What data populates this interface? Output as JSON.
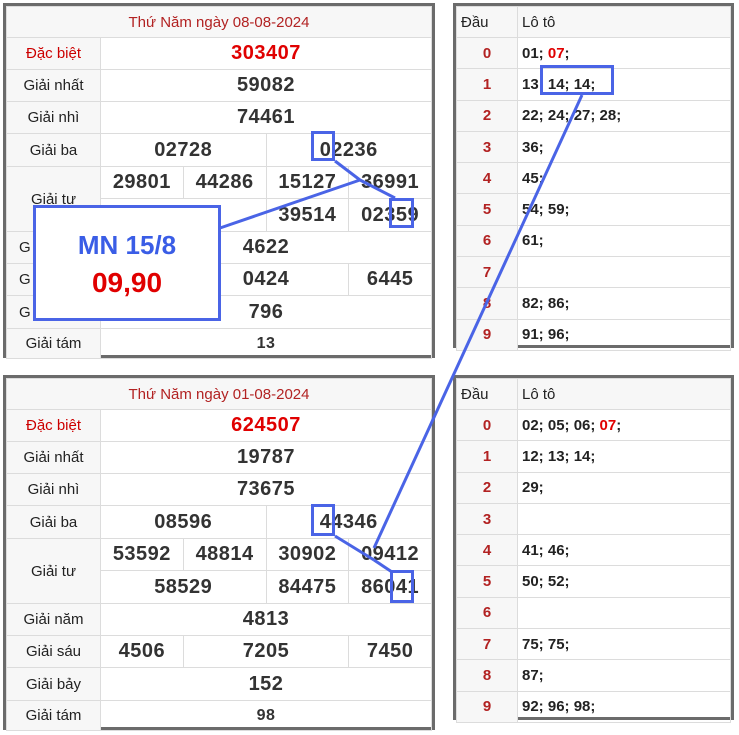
{
  "colors": {
    "accent_blue": "#4a64e6",
    "red": "#e00000",
    "border": "#6b6b6b"
  },
  "draw1": {
    "title": "Thứ Năm ngày 08-08-2024",
    "dac_biet_label": "Đặc biệt",
    "dac_biet": "303407",
    "nhat_label": "Giải nhất",
    "nhat": "59082",
    "nhi_label": "Giải nhì",
    "nhi": "74461",
    "ba_label": "Giải ba",
    "ba": [
      "02728",
      "02236"
    ],
    "tu_label": "Giải tư",
    "tu_row1": [
      "29801",
      "44286",
      "15127",
      "36991"
    ],
    "tu_row2": [
      "",
      "39514",
      "02359"
    ],
    "nam_label": "G",
    "nam": "4622",
    "sau_label": "G",
    "sau": [
      "",
      "0424",
      "6445"
    ],
    "bay_label": "G",
    "bay": "796",
    "tam_label": "Giải tám",
    "tam": "13"
  },
  "loto1": {
    "head_dau": "Đầu",
    "head_loto": "Lô tô",
    "rows": [
      {
        "d": "0",
        "pre": "01; ",
        "red": "07",
        "post": ";"
      },
      {
        "d": "1",
        "pre": "13; 14; 14;",
        "red": "",
        "post": ""
      },
      {
        "d": "2",
        "pre": "22; 24; 27; 28;",
        "red": "",
        "post": ""
      },
      {
        "d": "3",
        "pre": "36;",
        "red": "",
        "post": ""
      },
      {
        "d": "4",
        "pre": "45;",
        "red": "",
        "post": ""
      },
      {
        "d": "5",
        "pre": "54; 59;",
        "red": "",
        "post": ""
      },
      {
        "d": "6",
        "pre": "61;",
        "red": "",
        "post": ""
      },
      {
        "d": "7",
        "pre": "",
        "red": "",
        "post": ""
      },
      {
        "d": "8",
        "pre": "82; 86;",
        "red": "",
        "post": ""
      },
      {
        "d": "9",
        "pre": "91; 96;",
        "red": "",
        "post": ""
      }
    ]
  },
  "draw2": {
    "title": "Thứ Năm ngày 01-08-2024",
    "dac_biet_label": "Đặc biệt",
    "dac_biet": "624507",
    "nhat_label": "Giải nhất",
    "nhat": "19787",
    "nhi_label": "Giải nhì",
    "nhi": "73675",
    "ba_label": "Giải ba",
    "ba": [
      "08596",
      "44346"
    ],
    "tu_label": "Giải tư",
    "tu_row1": [
      "53592",
      "48814",
      "30902",
      "09412"
    ],
    "tu_row2": [
      "58529",
      "84475",
      "86041"
    ],
    "nam_label": "Giải năm",
    "nam": "4813",
    "sau_label": "Giải sáu",
    "sau": [
      "4506",
      "7205",
      "7450"
    ],
    "bay_label": "Giải bảy",
    "bay": "152",
    "tam_label": "Giải tám",
    "tam": "98"
  },
  "loto2": {
    "head_dau": "Đầu",
    "head_loto": "Lô tô",
    "rows": [
      {
        "d": "0",
        "pre": "02; 05; 06; ",
        "red": "07",
        "post": ";"
      },
      {
        "d": "1",
        "pre": "12; 13; 14;",
        "red": "",
        "post": ""
      },
      {
        "d": "2",
        "pre": "29;",
        "red": "",
        "post": ""
      },
      {
        "d": "3",
        "pre": "",
        "red": "",
        "post": ""
      },
      {
        "d": "4",
        "pre": "41; 46;",
        "red": "",
        "post": ""
      },
      {
        "d": "5",
        "pre": "50; 52;",
        "red": "",
        "post": ""
      },
      {
        "d": "6",
        "pre": "",
        "red": "",
        "post": ""
      },
      {
        "d": "7",
        "pre": "75; 75;",
        "red": "",
        "post": ""
      },
      {
        "d": "8",
        "pre": "87;",
        "red": "",
        "post": ""
      },
      {
        "d": "9",
        "pre": "92; 96; 98;",
        "red": "",
        "post": ""
      }
    ]
  },
  "callout": {
    "line1": "MN 15/8",
    "line2": "09,90"
  }
}
